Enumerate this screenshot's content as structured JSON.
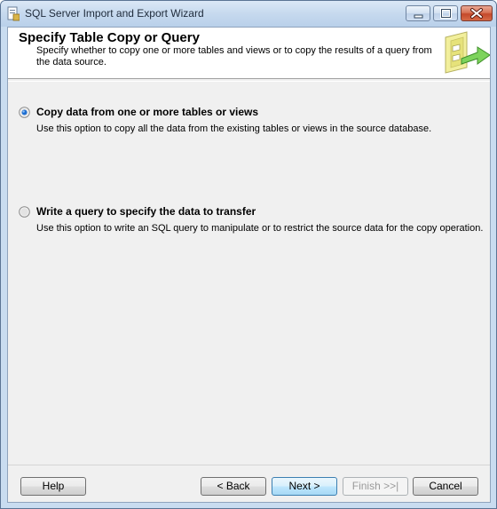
{
  "window": {
    "title": "SQL Server Import and Export Wizard"
  },
  "header": {
    "title": "Specify Table Copy or Query",
    "description": "Specify whether to copy one or more tables and views or to copy the results of a query from the data source."
  },
  "options": [
    {
      "label": "Copy data from one or more tables or views",
      "description": "Use this option to copy all the data from the existing tables or views in the source database.",
      "selected": true
    },
    {
      "label": "Write a query to specify the data to transfer",
      "description": "Use this option to write an SQL query to manipulate or to restrict the source data for the copy operation.",
      "selected": false
    }
  ],
  "buttons": {
    "help": "Help",
    "back": "< Back",
    "next": "Next >",
    "finish": "Finish >>|",
    "cancel": "Cancel"
  },
  "colors": {
    "titlebar": "#c6d9ee",
    "client_bg": "#f0f0f0",
    "close_button": "#c4482a",
    "default_button_border": "#3c7fb1"
  },
  "icons": {
    "app": "wizard-app-icon",
    "header": "data-transfer-graphic"
  }
}
